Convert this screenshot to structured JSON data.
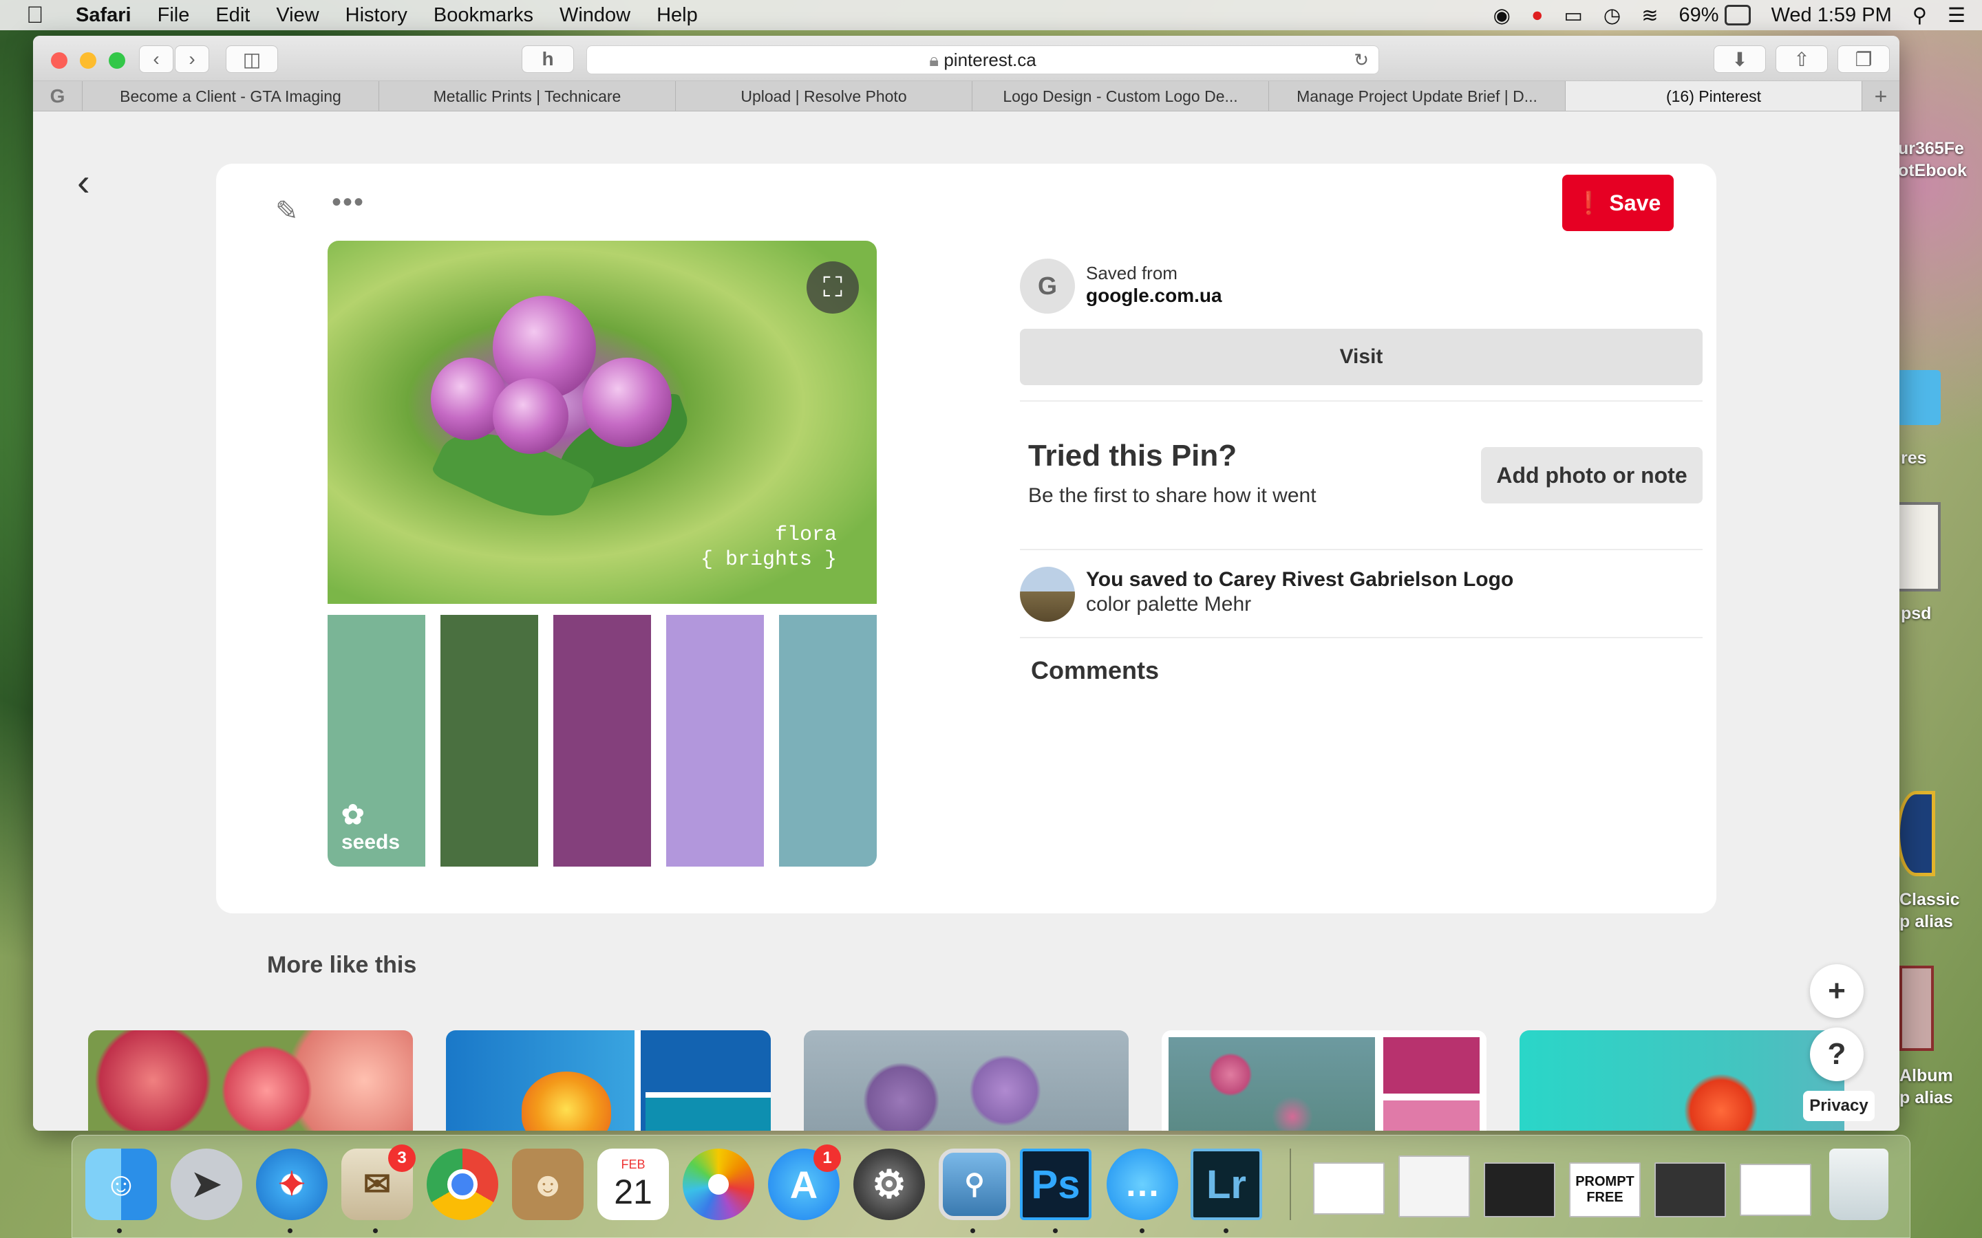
{
  "menubar": {
    "app": "Safari",
    "items": [
      "File",
      "Edit",
      "View",
      "History",
      "Bookmarks",
      "Window",
      "Help"
    ],
    "battery": "69%",
    "clock": "Wed 1:59 PM"
  },
  "browser": {
    "url": "pinterest.ca",
    "tabs": [
      {
        "label": "Become a Client - GTA Imaging",
        "active": false
      },
      {
        "label": "Metallic Prints | Technicare",
        "active": false
      },
      {
        "label": "Upload | Resolve Photo",
        "active": false
      },
      {
        "label": "Logo Design - Custom Logo De...",
        "active": false
      },
      {
        "label": "Manage Project Update Brief | D...",
        "active": false
      },
      {
        "label": "(16) Pinterest",
        "active": true
      }
    ]
  },
  "pin": {
    "save_label": "Save",
    "image_text_line1": "flora",
    "image_text_line2": "{ brights }",
    "swatch_brand": "seeds",
    "swatches": [
      "#7ab596",
      "#4a7040",
      "#84407c",
      "#b297dc",
      "#7cb0b9"
    ],
    "source_initial": "G",
    "saved_from_label": "Saved from",
    "source_domain": "google.com.ua",
    "visit_label": "Visit",
    "tried_title": "Tried this Pin?",
    "tried_subtitle": "Be the first to share how it went",
    "add_note_label": "Add photo or note",
    "saved_prefix": "You saved to",
    "board_name": "Carey Rivest Gabrielson Logo",
    "board_subtitle": "color palette Mehr",
    "comments_label": "Comments"
  },
  "more": {
    "heading": "More like this",
    "privacy_label": "Privacy",
    "add_icon": "+",
    "help_icon": "?"
  },
  "desktop": {
    "labels": [
      "ur365Fe",
      "otEbook",
      "res",
      "psd",
      "Classic",
      "p alias",
      "Album",
      "p alias"
    ]
  },
  "dock": {
    "mail_badge": "3",
    "calendar_month": "FEB",
    "calendar_day": "21",
    "appstore_badge": "1",
    "ps_label": "Ps",
    "lr_label": "Lr",
    "prompt_label_1": "PROMPT",
    "prompt_label_2": "FREE"
  }
}
